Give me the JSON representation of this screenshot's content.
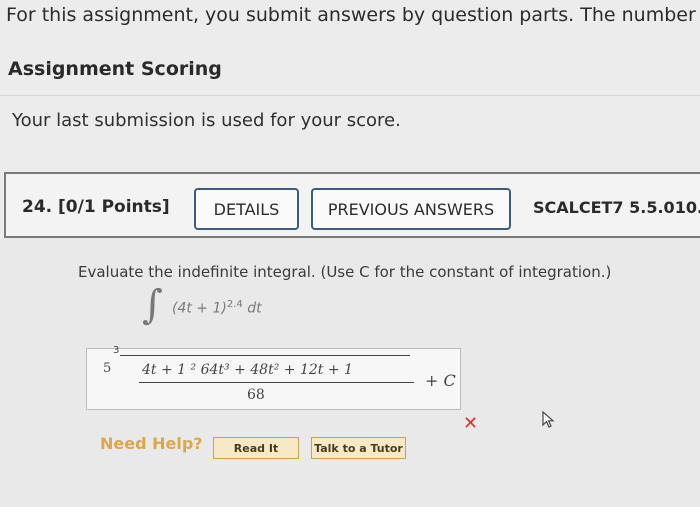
{
  "header": {
    "intro_text": "For this assignment, you submit answers by question parts. The number of subm",
    "scoring_title": "Assignment Scoring",
    "last_submission_text": "Your last submission is used for your score."
  },
  "question": {
    "number_label": "24.  [0/1 Points]",
    "details_button": "DETAILS",
    "previous_answers_button": "PREVIOUS ANSWERS",
    "code": "SCALCET7 5.5.010.",
    "prompt": "Evaluate the indefinite integral. (Use C for the constant of integration.)",
    "integral_symbol": "∫",
    "integrand_base": "(4t + 1)",
    "integrand_exponent": "2.4",
    "integrand_dt": "dt",
    "answer": {
      "radical_index": "3",
      "coefficient": "5",
      "numerator": "4t + 1  ²  64t³ + 48t² + 12t + 1",
      "denominator": "68",
      "constant": "+ C"
    },
    "status": "incorrect",
    "status_symbol": "✕"
  },
  "help": {
    "label": "Need Help?",
    "read_it": "Read It",
    "talk_to_tutor": "Talk to a Tutor"
  },
  "colors": {
    "button_border": "#3f5d7a",
    "wrong": "#dd3333",
    "help_text": "#d9a13a"
  }
}
